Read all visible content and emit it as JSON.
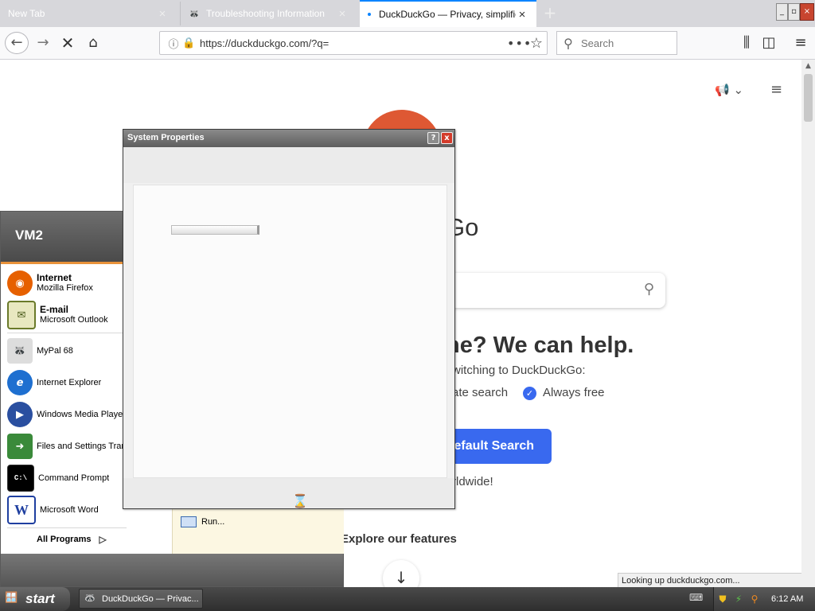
{
  "browser": {
    "tabs": [
      {
        "label": "New Tab"
      },
      {
        "label": "Troubleshooting Information"
      },
      {
        "label": "DuckDuckGo — Privacy, simplified."
      }
    ],
    "url": "https://duckduckgo.com/?q=",
    "search_placeholder": "Search",
    "status_text": "Looking up duckduckgo.com..."
  },
  "page": {
    "brand_partial": "Go",
    "headline_partial": "ne? We can help.",
    "sub_partial": "witching to DuckDuckGo:",
    "feature1_partial": "ate search",
    "feature2": "Always free",
    "cta_partial": "efault Search",
    "worldwide_partial": "rldwide!",
    "explore": "Explore our features"
  },
  "start_menu": {
    "user": "VM2",
    "pinned": [
      {
        "title": "Internet",
        "subtitle": "Mozilla Firefox",
        "icon": "firefox-icon",
        "color": "#e66000"
      },
      {
        "title": "E-mail",
        "subtitle": "Microsoft Outlook",
        "icon": "outlook-icon",
        "color": "#6a7a2a"
      }
    ],
    "recent": [
      {
        "label": "MyPal 68",
        "icon": "mypal-icon",
        "color": "#555555"
      },
      {
        "label": "Internet Explorer",
        "icon": "internet-explorer-icon",
        "color": "#1e6fd0"
      },
      {
        "label": "Windows Media Player",
        "icon": "media-player-icon",
        "color": "#2a4fa0"
      },
      {
        "label": "Files and Settings Transfer Wizard",
        "icon": "transfer-wizard-icon",
        "color": "#3a8a3a"
      },
      {
        "label": "Command Prompt",
        "icon": "command-prompt-icon",
        "color": "#000000"
      },
      {
        "label": "Microsoft Word",
        "icon": "word-icon",
        "color": "#1f3fa0"
      }
    ],
    "all_programs": "All Programs",
    "run": "Run..."
  },
  "dialog": {
    "title": "System Properties",
    "help": "?",
    "close": "x"
  },
  "taskbar": {
    "start_label": "start",
    "task_label": "DuckDuckGo — Privac...",
    "clock": "6:12 AM"
  }
}
